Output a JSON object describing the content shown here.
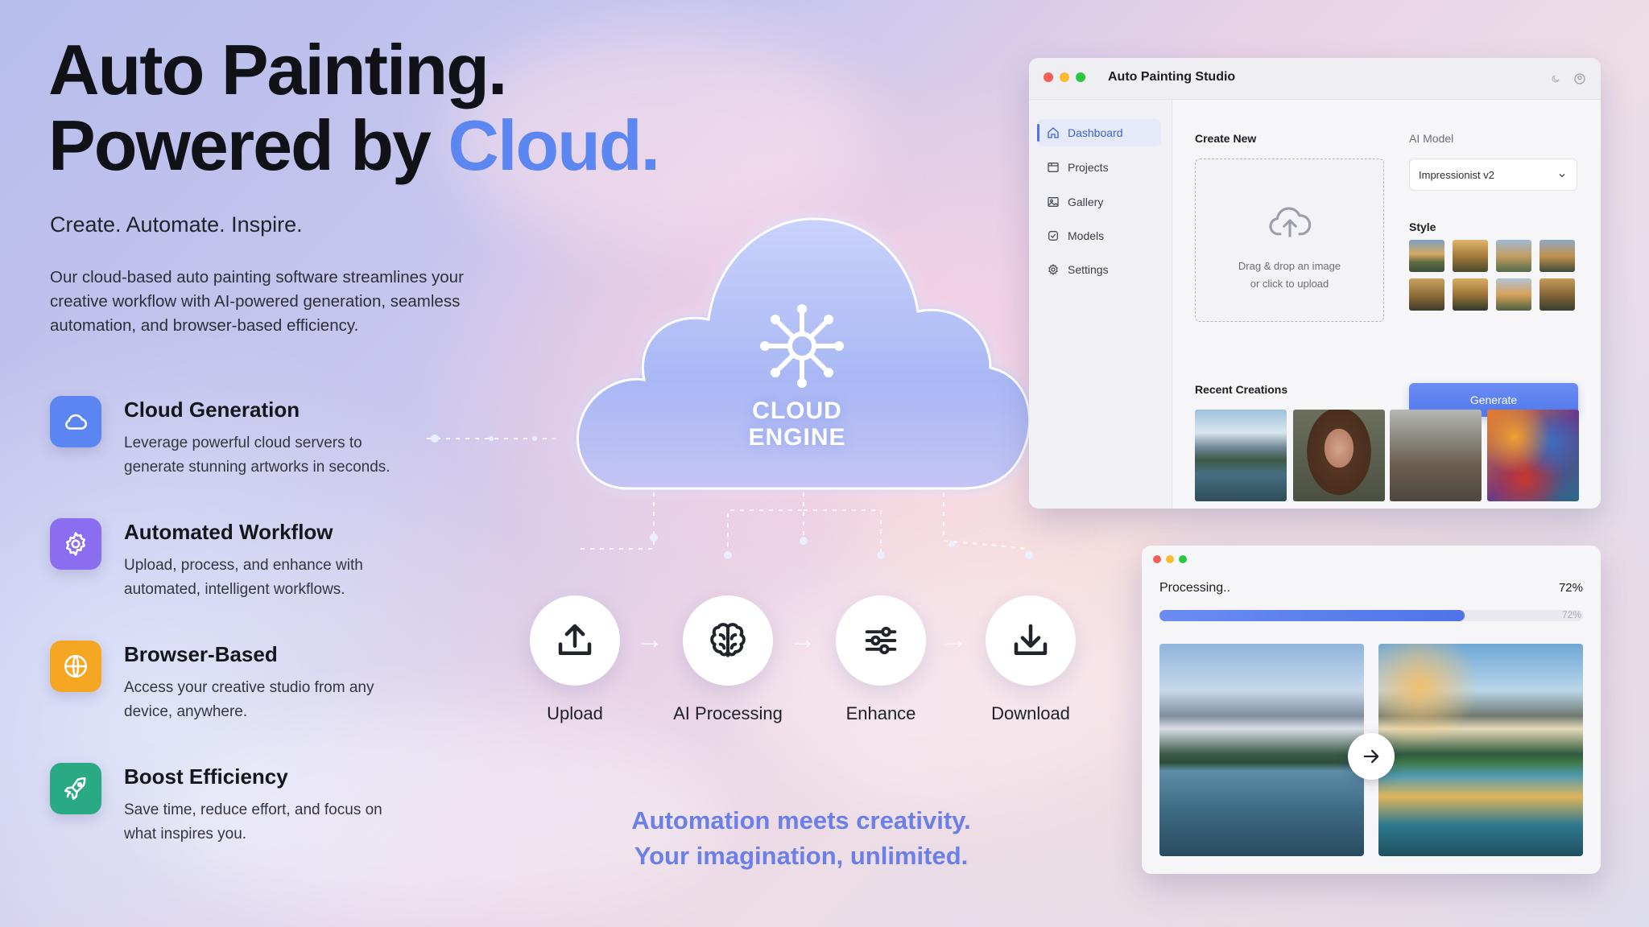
{
  "hero": {
    "title_line1": "Auto Painting.",
    "title_line2_prefix": "Powered by",
    "title_line2_accent": "Cloud.",
    "tagline": "Create. Automate. Inspire.",
    "intro": "Our cloud-based auto painting software streamlines your creative workflow with AI-powered generation, seamless automation, and browser-based efficiency."
  },
  "features": [
    {
      "title": "Cloud Generation",
      "desc": "Leverage powerful cloud servers to generate stunning artworks in seconds.",
      "icon": "cloud-icon",
      "color": "#5b86f2"
    },
    {
      "title": "Automated Workflow",
      "desc": "Upload, process, and enhance with automated, intelligent workflows.",
      "icon": "gear-icon",
      "color": "#8b6ef0"
    },
    {
      "title": "Browser-Based",
      "desc": "Access your creative studio from any device, anywhere.",
      "icon": "globe-icon",
      "color": "#f5a623"
    },
    {
      "title": "Boost Efficiency",
      "desc": "Save time, reduce effort, and focus on what inspires you.",
      "icon": "rocket-icon",
      "color": "#2aa985"
    }
  ],
  "engine": {
    "line1": "CLOUD",
    "line2": "ENGINE",
    "icon": "network-hub-icon"
  },
  "pipeline": [
    {
      "label": "Upload",
      "icon": "upload-icon"
    },
    {
      "label": "AI Processing",
      "icon": "brain-icon"
    },
    {
      "label": "Enhance",
      "icon": "sliders-icon"
    },
    {
      "label": "Download",
      "icon": "download-icon"
    }
  ],
  "motto": {
    "line1": "Automation meets creativity.",
    "line2": "Your imagination, unlimited."
  },
  "app": {
    "title": "Auto Painting Studio",
    "sidebar": [
      {
        "label": "Dashboard",
        "icon": "home-icon",
        "active": true
      },
      {
        "label": "Projects",
        "icon": "folder-icon",
        "active": false
      },
      {
        "label": "Gallery",
        "icon": "image-icon",
        "active": false
      },
      {
        "label": "Models",
        "icon": "cube-icon",
        "active": false
      },
      {
        "label": "Settings",
        "icon": "gear-icon",
        "active": false
      }
    ],
    "create_new": "Create New",
    "upload_hint_line1": "Drag & drop an image",
    "upload_hint_line2": "or click to upload",
    "ai_model_label": "AI Model",
    "ai_model_value": "Impressionist v2",
    "style_label": "Style",
    "generate_label": "Generate",
    "recent_label": "Recent Creations",
    "recent": [
      "mountain-lake",
      "portrait",
      "city-street",
      "abstract-colors"
    ]
  },
  "processing": {
    "label": "Processing..",
    "percent_text": "72%",
    "progress": 0.72
  },
  "colors": {
    "accent": "#5c86f0",
    "button": "#5a7ff0",
    "motto": "#6b7fe8"
  }
}
